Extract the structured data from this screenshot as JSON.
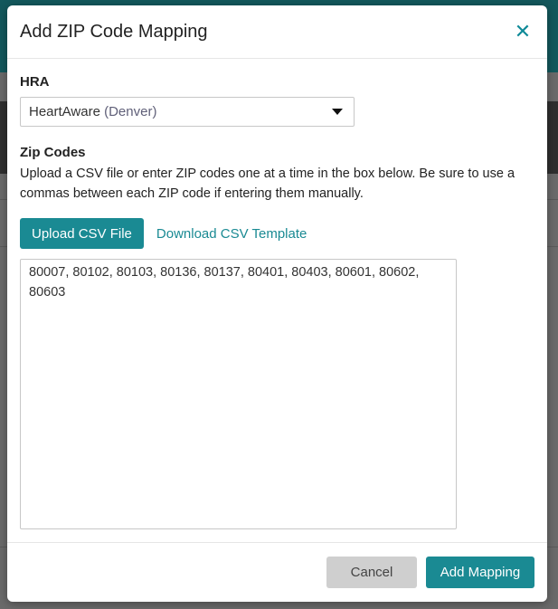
{
  "modal": {
    "title": "Add ZIP Code Mapping",
    "close_icon": "close-icon"
  },
  "hra": {
    "label": "HRA",
    "selected_value": "HeartAware",
    "selected_sub": "(Denver)",
    "caret_icon": "caret-down-icon"
  },
  "zip": {
    "label": "Zip Codes",
    "help_text": "Upload a CSV file or enter ZIP codes one at a time in the box below. Be sure to use a commas between each ZIP code if entering them manually.",
    "upload_button": "Upload CSV File",
    "template_link": "Download CSV Template",
    "textarea_value": "80007, 80102, 80103, 80136, 80137, 80401, 80403, 80601, 80602, 80603"
  },
  "footer": {
    "cancel_label": "Cancel",
    "submit_label": "Add Mapping"
  },
  "colors": {
    "accent": "#1a8a93",
    "close": "#0f8a98",
    "cancel_bg": "#cfcfcf"
  }
}
